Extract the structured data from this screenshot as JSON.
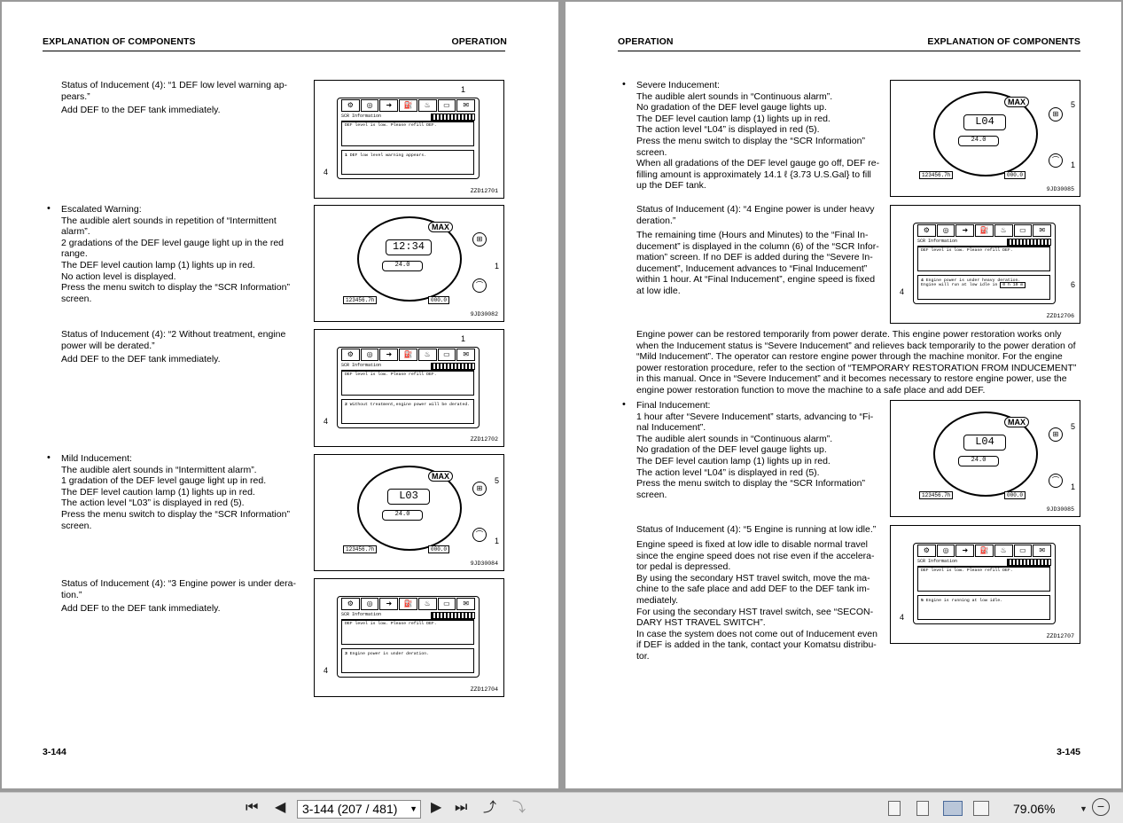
{
  "left_page": {
    "header_left": "EXPLANATION OF COMPONENTS",
    "header_right": "OPERATION",
    "page_number": "3-144",
    "sections": [
      {
        "lines": [
          "Status of Inducement (4): “1 DEF low level warning ap-",
          "pears.”"
        ],
        "extra": "Add DEF to the DEF tank immediately."
      },
      {
        "bullet": "•",
        "lines": [
          "Escalated Warning:",
          "The audible alert sounds in repetition of “Intermittent",
          "alarm”.",
          "2 gradations of the DEF level gauge light up in the red",
          "range.",
          "The DEF level caution lamp (1) lights up in red.",
          "No action level is displayed.",
          "Press the menu switch to display the “SCR Information”",
          "screen."
        ]
      },
      {
        "lines": [
          "Status of Inducement (4): “2 Without treatment, engine",
          "power will be derated.”"
        ],
        "extra": "Add DEF to the DEF tank immediately."
      },
      {
        "bullet": "•",
        "lines": [
          "Mild Inducement:",
          "The audible alert sounds in “Intermittent alarm”.",
          "1 gradation of the DEF level gauge light up in red.",
          "The DEF level caution lamp (1) lights up in red.",
          "The action level “L03” is displayed in red (5).",
          "Press the menu switch to display the “SCR Information”",
          "screen."
        ]
      },
      {
        "lines": [
          "Status of Inducement (4): “3 Engine power is under dera-",
          "tion.”"
        ],
        "extra": "Add DEF to the DEF tank immediately."
      }
    ],
    "figures": [
      {
        "code": "ZZD12701",
        "title": "SCR Information",
        "msg": "DEF level is low. Please refill DEF.",
        "num": "1",
        "status": "DEF low level warning appears."
      },
      {
        "code": "9JD30082",
        "display": "12:34",
        "max": "MAX",
        "hour": "123456.7h",
        "fuel": "24.0",
        "speed": "000.0"
      },
      {
        "code": "ZZD12702",
        "title": "SCR Information",
        "msg": "DEF level is low. Please refill DEF.",
        "num": "2",
        "status": "Without treatment,engine power will be derated."
      },
      {
        "code": "9JD30084",
        "display": "L03",
        "max": "MAX",
        "hour": "123456.7h",
        "fuel": "24.0",
        "speed": "000.0"
      },
      {
        "code": "ZZD12704",
        "title": "SCR Information",
        "msg": "DEF level is low. Please refill DEF.",
        "num": "3",
        "status": "Engine power is under deration."
      }
    ]
  },
  "right_page": {
    "header_left": "OPERATION",
    "header_right": "EXPLANATION OF COMPONENTS",
    "page_number": "3-145",
    "sections": [
      {
        "bullet": "•",
        "lines": [
          "Severe Inducement:",
          "The audible alert sounds in “Continuous alarm”.",
          "No gradation of the DEF level gauge lights up.",
          "The DEF level caution lamp (1) lights up in red.",
          "The action level “L04” is displayed in red (5).",
          "Press the menu switch to display the “SCR Information”",
          "screen.",
          "When all gradations of the DEF level gauge go off, DEF re-",
          "filling amount is approximately 14.1 ℓ {3.73 U.S.Gal} to fill",
          "up the DEF tank."
        ]
      },
      {
        "lines": [
          "Status of Inducement (4): “4 Engine power is under heavy",
          "deration.”"
        ]
      },
      {
        "lines": [
          "The remaining time (Hours and Minutes) to the “Final In-",
          "ducement” is displayed in the column (6) of the “SCR Infor-",
          "mation” screen. If no DEF is added during the “Severe In-",
          "ducement”, Inducement advances to “Final Inducement”",
          "within 1 hour. At “Final Inducement”, engine speed is fixed",
          "at low idle."
        ]
      },
      {
        "lines": [
          "Engine power can be restored temporarily from power derate. This engine power restoration works only",
          "when the Inducement status is “Severe Inducement” and relieves back temporarily to the power deration of",
          "“Mild Inducement”. The operator can restore engine power through the machine monitor. For the engine",
          "power restoration procedure, refer to the section of “TEMPORARY RESTORATION FROM INDUCEMENT”",
          "in this manual. Once in “Severe Inducement” and it becomes necessary to restore engine power, use the",
          "engine power restoration function to move the machine to a safe place and add DEF."
        ]
      },
      {
        "bullet": "•",
        "lines": [
          "Final Inducement:",
          "1 hour after “Severe Inducement” starts, advancing to “Fi-",
          "nal Inducement”.",
          "The audible alert sounds in “Continuous alarm”.",
          "No gradation of the DEF level gauge lights up.",
          "The DEF level caution lamp (1) lights up in red.",
          "The action level “L04” is displayed in red (5).",
          "Press the menu switch to display the “SCR Information”",
          "screen."
        ]
      },
      {
        "lines": [
          "Status of Inducement (4): “5 Engine is running at low idle.”"
        ]
      },
      {
        "lines": [
          "Engine speed is fixed at low idle to disable normal travel",
          "since the engine speed does not rise even if the accelera-",
          "tor pedal is depressed.",
          "By using the secondary HST travel switch, move the ma-",
          "chine to the safe place and add DEF to the DEF tank im-",
          "mediately.",
          "For using the secondary HST travel switch, see “SECON-",
          "DARY HST TRAVEL SWITCH”.",
          "In case the system does not come out of Inducement even",
          "if DEF is added in the tank, contact your Komatsu distribu-",
          "tor."
        ]
      }
    ],
    "figures": [
      {
        "code": "9JD30085",
        "display": "L04",
        "max": "MAX",
        "hour": "123456.7h",
        "fuel": "24.0",
        "speed": "000.0"
      },
      {
        "code": "ZZD12706",
        "title": "SCR Information",
        "msg": "DEF level is low. Please refill DEF.",
        "num": "4",
        "status": "Engine power is under heavy deration.",
        "status2": "Engine will run at low idle in",
        "remaining": "0 h 10 m"
      },
      {
        "code": "9JD30085",
        "display": "L04",
        "max": "MAX",
        "hour": "123456.7h",
        "fuel": "24.0",
        "speed": "000.0"
      },
      {
        "code": "ZZD12707",
        "title": "SCR Information",
        "msg": "DEF level is low. Please refill DEF.",
        "num": "5",
        "status": "Engine is running at low idle."
      }
    ]
  },
  "toolbar": {
    "page_field": "3-144 (207 / 481)",
    "zoom": "79.06%",
    "first_glyph": "⏮",
    "prev_glyph": "◀",
    "next_glyph": "▶",
    "last_glyph": "⏭",
    "minus_glyph": "−"
  },
  "colors": {
    "background": "#9a9a9a",
    "page": "#ffffff",
    "toolbar": "#e8e8e8"
  }
}
